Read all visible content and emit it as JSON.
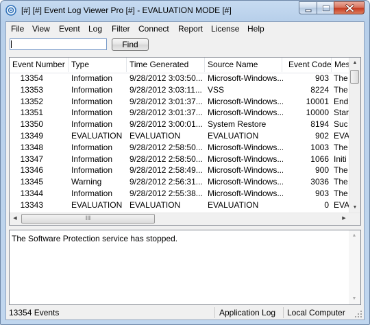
{
  "window": {
    "title": "[#] [#] Event Log Viewer Pro [#] - EVALUATION MODE [#]",
    "accent": "#c7dbf1"
  },
  "menu": [
    "File",
    "View",
    "Event",
    "Log",
    "Filter",
    "Connect",
    "Report",
    "License",
    "Help"
  ],
  "search": {
    "value": "",
    "placeholder": ""
  },
  "find_label": "Find",
  "columns": [
    "Event Number",
    "Type",
    "Time Generated",
    "Source Name",
    "Event Code",
    "Mes"
  ],
  "rows": [
    {
      "num": "13354",
      "type": "Information",
      "time": "9/28/2012 3:03:50...",
      "source": "Microsoft-Windows...",
      "code": "903",
      "msg": "The"
    },
    {
      "num": "13353",
      "type": "Information",
      "time": "9/28/2012 3:03:11...",
      "source": "VSS",
      "code": "8224",
      "msg": "The"
    },
    {
      "num": "13352",
      "type": "Information",
      "time": "9/28/2012 3:01:37...",
      "source": "Microsoft-Windows...",
      "code": "10001",
      "msg": "End"
    },
    {
      "num": "13351",
      "type": "Information",
      "time": "9/28/2012 3:01:37...",
      "source": "Microsoft-Windows...",
      "code": "10000",
      "msg": "Star"
    },
    {
      "num": "13350",
      "type": "Information",
      "time": "9/28/2012 3:00:01...",
      "source": "System Restore",
      "code": "8194",
      "msg": "Suc"
    },
    {
      "num": "13349",
      "type": "EVALUATION",
      "time": "EVALUATION",
      "source": "EVALUATION",
      "code": "902",
      "msg": "EVA"
    },
    {
      "num": "13348",
      "type": "Information",
      "time": "9/28/2012 2:58:50...",
      "source": "Microsoft-Windows...",
      "code": "1003",
      "msg": "The"
    },
    {
      "num": "13347",
      "type": "Information",
      "time": "9/28/2012 2:58:50...",
      "source": "Microsoft-Windows...",
      "code": "1066",
      "msg": "Initi"
    },
    {
      "num": "13346",
      "type": "Information",
      "time": "9/28/2012 2:58:49...",
      "source": "Microsoft-Windows...",
      "code": "900",
      "msg": "The"
    },
    {
      "num": "13345",
      "type": "Warning",
      "time": "9/28/2012 2:56:31...",
      "source": "Microsoft-Windows...",
      "code": "3036",
      "msg": "The"
    },
    {
      "num": "13344",
      "type": "Information",
      "time": "9/28/2012 2:55:38...",
      "source": "Microsoft-Windows...",
      "code": "903",
      "msg": "The"
    },
    {
      "num": "13343",
      "type": "EVALUATION",
      "time": "EVALUATION",
      "source": "EVALUATION",
      "code": "0",
      "msg": "EVA"
    }
  ],
  "hscroll_thumb": "III",
  "detail_text": "The Software Protection service has stopped.",
  "status": {
    "count": "13354 Events",
    "log": "Application Log",
    "computer": "Local Computer"
  }
}
